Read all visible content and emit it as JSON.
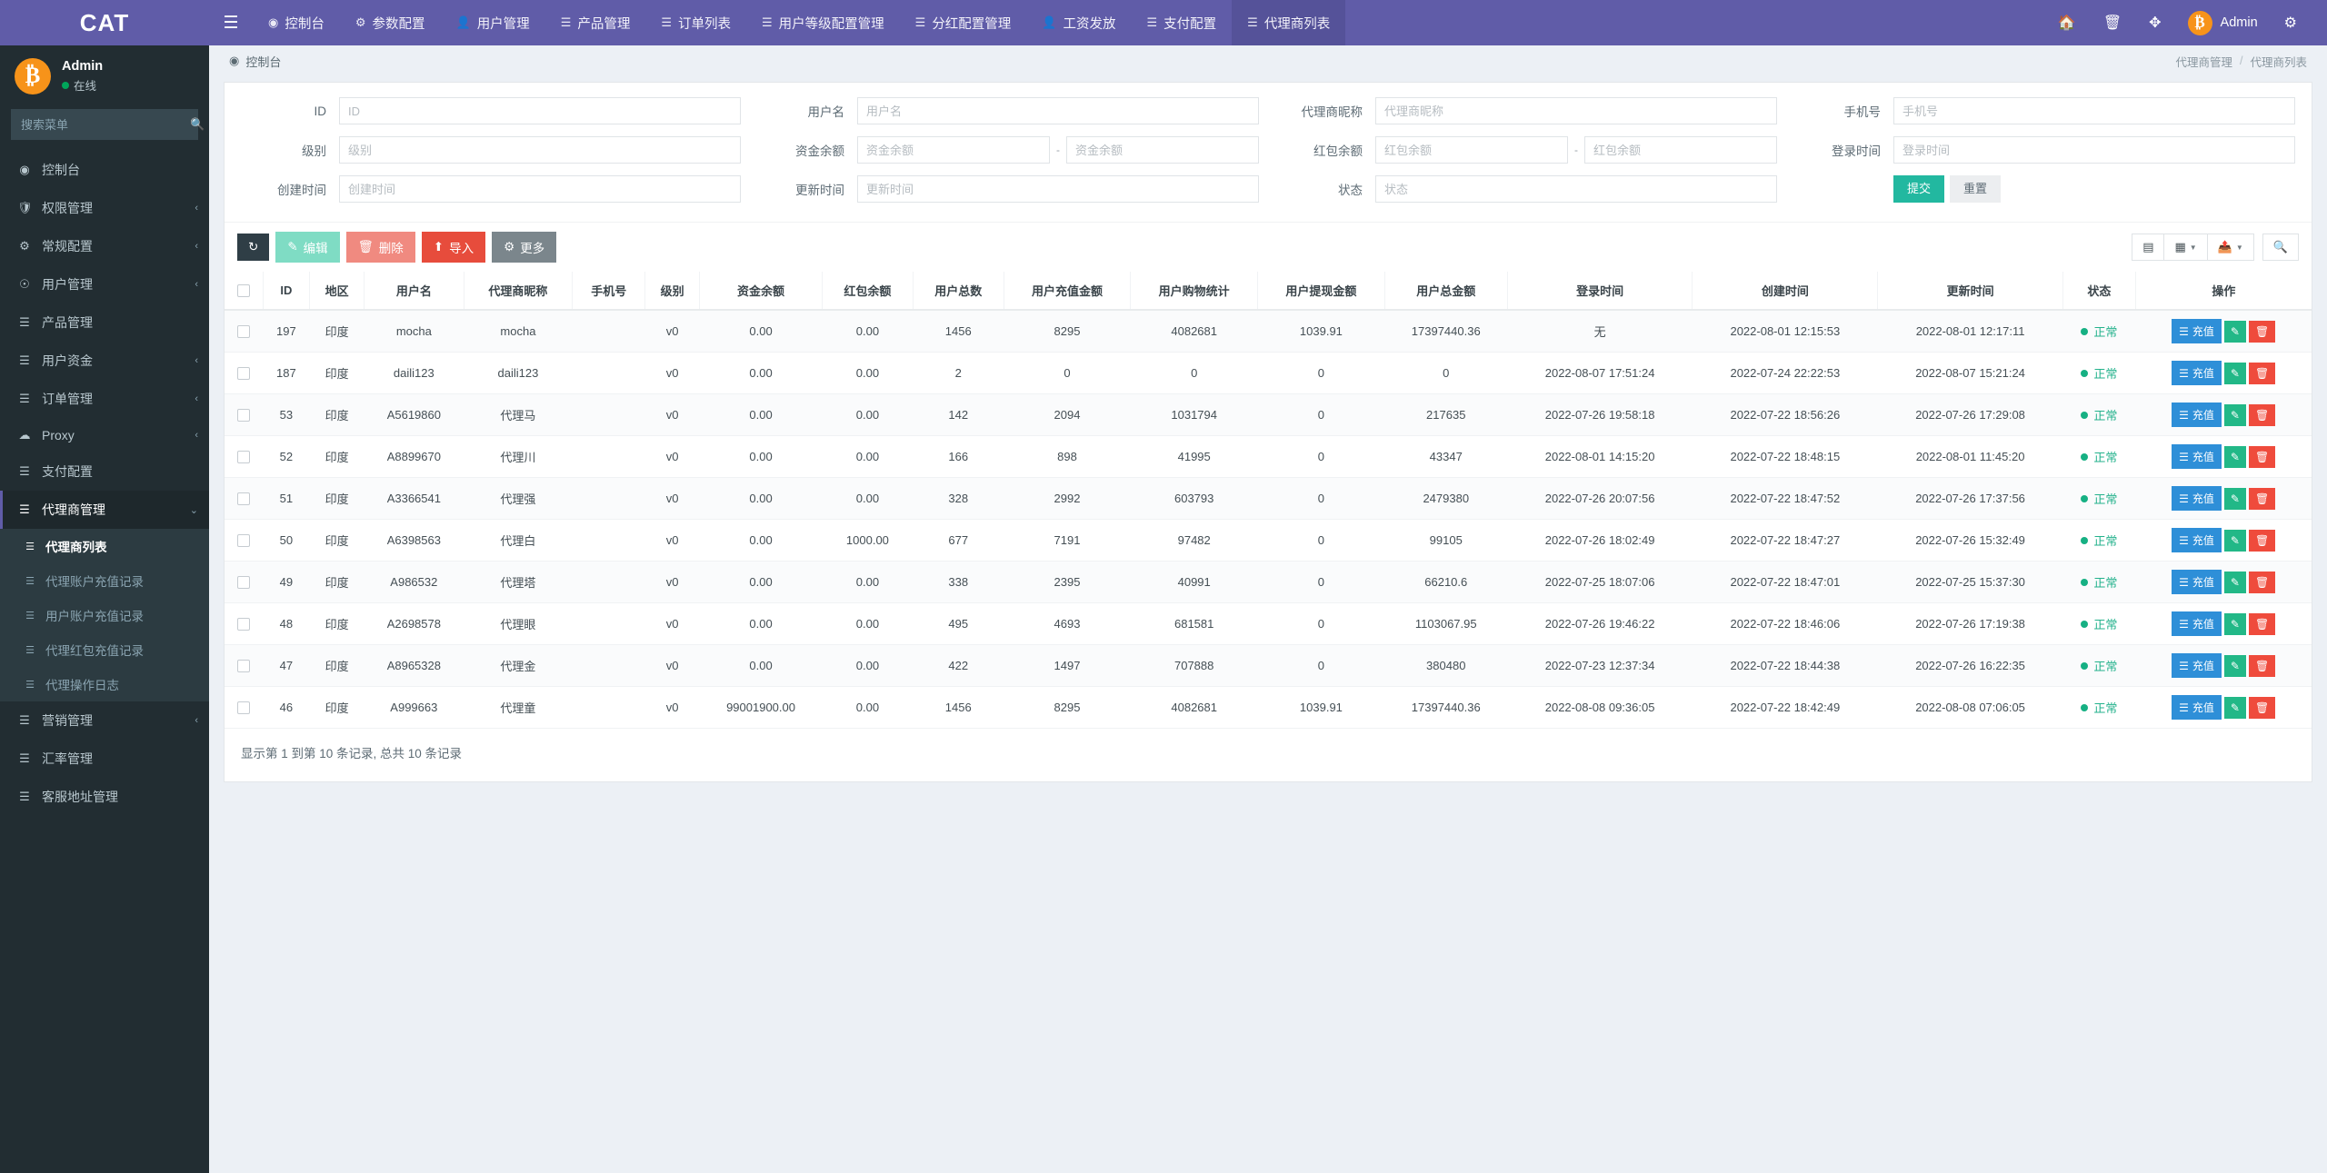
{
  "brand": {
    "title": "CAT"
  },
  "topnav": {
    "hamburger_icon": "bars-icon",
    "items": [
      {
        "label": "控制台",
        "icon": "dashboard-icon",
        "active": false
      },
      {
        "label": "参数配置",
        "icon": "gear-icon",
        "active": false
      },
      {
        "label": "用户管理",
        "icon": "user-icon",
        "active": false
      },
      {
        "label": "产品管理",
        "icon": "list-icon",
        "active": false
      },
      {
        "label": "订单列表",
        "icon": "list-icon",
        "active": false
      },
      {
        "label": "用户等级配置管理",
        "icon": "list-icon",
        "active": false
      },
      {
        "label": "分红配置管理",
        "icon": "list-icon",
        "active": false
      },
      {
        "label": "工资发放",
        "icon": "user-icon",
        "active": false
      },
      {
        "label": "支付配置",
        "icon": "list-icon",
        "active": false
      },
      {
        "label": "代理商列表",
        "icon": "list-icon",
        "active": true
      }
    ],
    "right": {
      "home_icon": "home-icon",
      "trash_icon": "trash-icon",
      "fullscreen_icon": "expand-icon",
      "avatar_glyph": "₿",
      "user_label": "Admin",
      "settings_icon": "gears-icon"
    }
  },
  "sidebar": {
    "user": {
      "avatar_glyph": "₿",
      "name": "Admin",
      "status": "在线"
    },
    "search": {
      "placeholder": "搜索菜单",
      "icon": "search-icon"
    },
    "items": [
      {
        "label": "控制台",
        "icon": "dashboard-icon",
        "arrow": ""
      },
      {
        "label": "权限管理",
        "icon": "shield-icon",
        "arrow": "‹"
      },
      {
        "label": "常规配置",
        "icon": "gears-icon",
        "arrow": "‹"
      },
      {
        "label": "用户管理",
        "icon": "user-circle-icon",
        "arrow": "‹"
      },
      {
        "label": "产品管理",
        "icon": "list-icon",
        "arrow": ""
      },
      {
        "label": "用户资金",
        "icon": "list-icon",
        "arrow": "‹"
      },
      {
        "label": "订单管理",
        "icon": "list-icon",
        "arrow": "‹"
      },
      {
        "label": "Proxy",
        "icon": "cloud-icon",
        "arrow": "‹"
      },
      {
        "label": "支付配置",
        "icon": "list-icon",
        "arrow": ""
      }
    ],
    "agent_group": {
      "label": "代理商管理",
      "icon": "list-icon",
      "arrow": "⌄"
    },
    "agent_children": [
      {
        "label": "代理商列表",
        "icon": "list-icon",
        "active": true
      },
      {
        "label": "代理账户充值记录",
        "icon": "list-icon",
        "active": false
      },
      {
        "label": "用户账户充值记录",
        "icon": "list-icon",
        "active": false
      },
      {
        "label": "代理红包充值记录",
        "icon": "list-icon",
        "active": false
      },
      {
        "label": "代理操作日志",
        "icon": "list-icon",
        "active": false
      }
    ],
    "tail_items": [
      {
        "label": "营销管理",
        "icon": "list-icon",
        "arrow": "‹"
      },
      {
        "label": "汇率管理",
        "icon": "list-icon",
        "arrow": ""
      },
      {
        "label": "客服地址管理",
        "icon": "list-icon",
        "arrow": ""
      }
    ]
  },
  "breadcrumb": {
    "icon": "dashboard-icon",
    "home": "控制台",
    "trail_parent": "代理商管理",
    "separator": "/",
    "trail_current": "代理商列表"
  },
  "filters": {
    "id": {
      "label": "ID",
      "placeholder": "ID",
      "value": ""
    },
    "username": {
      "label": "用户名",
      "placeholder": "用户名",
      "value": ""
    },
    "agent_nick": {
      "label": "代理商昵称",
      "placeholder": "代理商昵称",
      "value": ""
    },
    "phone": {
      "label": "手机号",
      "placeholder": "手机号",
      "value": ""
    },
    "level": {
      "label": "级别",
      "placeholder": "级别",
      "value": ""
    },
    "fund_balance": {
      "label": "资金余额",
      "placeholder_from": "资金余额",
      "placeholder_to": "资金余额",
      "dash": "-"
    },
    "red_balance": {
      "label": "红包余额",
      "placeholder_from": "红包余额",
      "placeholder_to": "红包余额",
      "dash": "-"
    },
    "login_time": {
      "label": "登录时间",
      "placeholder": "登录时间",
      "value": ""
    },
    "create_time": {
      "label": "创建时间",
      "placeholder": "创建时间",
      "value": ""
    },
    "update_time": {
      "label": "更新时间",
      "placeholder": "更新时间",
      "value": ""
    },
    "status": {
      "label": "状态",
      "placeholder": "状态",
      "value": ""
    },
    "submit_label": "提交",
    "reset_label": "重置"
  },
  "toolbar": {
    "refresh_icon": "refresh-icon",
    "edit_label": "编辑",
    "edit_icon": "pencil-icon",
    "delete_label": "删除",
    "delete_icon": "trash-icon",
    "import_label": "导入",
    "import_icon": "upload-icon",
    "more_label": "更多",
    "more_icon": "gear-icon",
    "view_icon": "table-view-icon",
    "columns_icon": "grid-icon",
    "export_icon": "export-icon",
    "search_icon": "search-icon"
  },
  "table": {
    "columns": [
      "ID",
      "地区",
      "用户名",
      "代理商昵称",
      "手机号",
      "级别",
      "资金余额",
      "红包余额",
      "用户总数",
      "用户充值金额",
      "用户购物统计",
      "用户提现金额",
      "用户总金额",
      "登录时间",
      "创建时间",
      "更新时间",
      "状态",
      "操作"
    ],
    "rows": [
      {
        "id": "197",
        "region": "印度",
        "username": "mocha",
        "nick": "mocha",
        "phone": "",
        "level": "v0",
        "fund": "0.00",
        "red": "0.00",
        "user_total": "1456",
        "recharge": "8295",
        "shopping": "4082681",
        "withdraw": "1039.91",
        "total_amount": "17397440.36",
        "login_time": "无",
        "create_time": "2022-08-01 12:15:53",
        "update_time": "2022-08-01 12:17:11",
        "status": "正常"
      },
      {
        "id": "187",
        "region": "印度",
        "username": "daili123",
        "nick": "daili123",
        "phone": "",
        "level": "v0",
        "fund": "0.00",
        "red": "0.00",
        "user_total": "2",
        "recharge": "0",
        "shopping": "0",
        "withdraw": "0",
        "total_amount": "0",
        "login_time": "2022-08-07 17:51:24",
        "create_time": "2022-07-24 22:22:53",
        "update_time": "2022-08-07 15:21:24",
        "status": "正常"
      },
      {
        "id": "53",
        "region": "印度",
        "username": "A5619860",
        "nick": "代理马",
        "phone": "",
        "level": "v0",
        "fund": "0.00",
        "red": "0.00",
        "user_total": "142",
        "recharge": "2094",
        "shopping": "1031794",
        "withdraw": "0",
        "total_amount": "217635",
        "login_time": "2022-07-26 19:58:18",
        "create_time": "2022-07-22 18:56:26",
        "update_time": "2022-07-26 17:29:08",
        "status": "正常"
      },
      {
        "id": "52",
        "region": "印度",
        "username": "A8899670",
        "nick": "代理川",
        "phone": "",
        "level": "v0",
        "fund": "0.00",
        "red": "0.00",
        "user_total": "166",
        "recharge": "898",
        "shopping": "41995",
        "withdraw": "0",
        "total_amount": "43347",
        "login_time": "2022-08-01 14:15:20",
        "create_time": "2022-07-22 18:48:15",
        "update_time": "2022-08-01 11:45:20",
        "status": "正常"
      },
      {
        "id": "51",
        "region": "印度",
        "username": "A3366541",
        "nick": "代理强",
        "phone": "",
        "level": "v0",
        "fund": "0.00",
        "red": "0.00",
        "user_total": "328",
        "recharge": "2992",
        "shopping": "603793",
        "withdraw": "0",
        "total_amount": "2479380",
        "login_time": "2022-07-26 20:07:56",
        "create_time": "2022-07-22 18:47:52",
        "update_time": "2022-07-26 17:37:56",
        "status": "正常"
      },
      {
        "id": "50",
        "region": "印度",
        "username": "A6398563",
        "nick": "代理白",
        "phone": "",
        "level": "v0",
        "fund": "0.00",
        "red": "1000.00",
        "user_total": "677",
        "recharge": "7191",
        "shopping": "97482",
        "withdraw": "0",
        "total_amount": "99105",
        "login_time": "2022-07-26 18:02:49",
        "create_time": "2022-07-22 18:47:27",
        "update_time": "2022-07-26 15:32:49",
        "status": "正常"
      },
      {
        "id": "49",
        "region": "印度",
        "username": "A986532",
        "nick": "代理塔",
        "phone": "",
        "level": "v0",
        "fund": "0.00",
        "red": "0.00",
        "user_total": "338",
        "recharge": "2395",
        "shopping": "40991",
        "withdraw": "0",
        "total_amount": "66210.6",
        "login_time": "2022-07-25 18:07:06",
        "create_time": "2022-07-22 18:47:01",
        "update_time": "2022-07-25 15:37:30",
        "status": "正常"
      },
      {
        "id": "48",
        "region": "印度",
        "username": "A2698578",
        "nick": "代理眼",
        "phone": "",
        "level": "v0",
        "fund": "0.00",
        "red": "0.00",
        "user_total": "495",
        "recharge": "4693",
        "shopping": "681581",
        "withdraw": "0",
        "total_amount": "1103067.95",
        "login_time": "2022-07-26 19:46:22",
        "create_time": "2022-07-22 18:46:06",
        "update_time": "2022-07-26 17:19:38",
        "status": "正常"
      },
      {
        "id": "47",
        "region": "印度",
        "username": "A8965328",
        "nick": "代理金",
        "phone": "",
        "level": "v0",
        "fund": "0.00",
        "red": "0.00",
        "user_total": "422",
        "recharge": "1497",
        "shopping": "707888",
        "withdraw": "0",
        "total_amount": "380480",
        "login_time": "2022-07-23 12:37:34",
        "create_time": "2022-07-22 18:44:38",
        "update_time": "2022-07-26 16:22:35",
        "status": "正常"
      },
      {
        "id": "46",
        "region": "印度",
        "username": "A999663",
        "nick": "代理童",
        "phone": "",
        "level": "v0",
        "fund": "99001900.00",
        "red": "0.00",
        "user_total": "1456",
        "recharge": "8295",
        "shopping": "4082681",
        "withdraw": "1039.91",
        "total_amount": "17397440.36",
        "login_time": "2022-08-08 09:36:05",
        "create_time": "2022-07-22 18:42:49",
        "update_time": "2022-08-08 07:06:05",
        "status": "正常"
      }
    ],
    "row_actions": {
      "recharge_label": "充值",
      "recharge_icon": "list-icon",
      "edit_icon": "pencil-icon",
      "delete_icon": "trash-icon"
    },
    "footer_text": "显示第 1 到第 10 条记录, 总共 10 条记录"
  },
  "colors": {
    "brand_purple": "#605ca8",
    "sidebar_dark": "#222d32",
    "accent_green": "#22b8a0",
    "danger_red": "#e74c3c",
    "info_blue": "#2e8fd8",
    "status_green": "#16b083",
    "bitcoin_orange": "#f7931a"
  }
}
